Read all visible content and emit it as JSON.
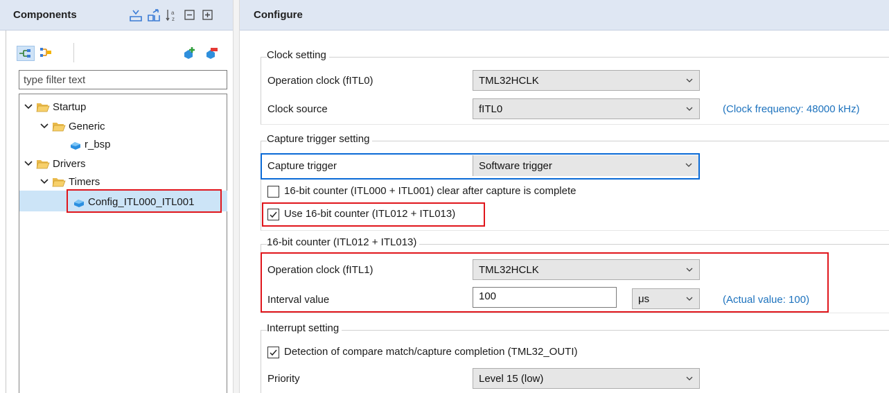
{
  "components": {
    "title": "Components",
    "header_icons": [
      "collapse-view-icon",
      "expand-view-icon",
      "sort-az-icon",
      "collapse-all-icon",
      "expand-all-icon"
    ],
    "toolbar_icons": [
      "hierarchical-view-icon",
      "flat-view-icon",
      "add-component-icon",
      "remove-component-icon"
    ],
    "filter_placeholder": "type filter text",
    "tree": [
      {
        "label": "Startup",
        "type": "folder",
        "expanded": true
      },
      {
        "label": "Generic",
        "type": "folder",
        "expanded": true
      },
      {
        "label": "r_bsp",
        "type": "component"
      },
      {
        "label": "Drivers",
        "type": "folder",
        "expanded": true
      },
      {
        "label": "Timers",
        "type": "folder",
        "expanded": true
      },
      {
        "label": "Config_ITL000_ITL001",
        "type": "component",
        "selected": true
      }
    ]
  },
  "configure": {
    "title": "Configure",
    "clock_setting": {
      "title": "Clock setting",
      "operation_clock_label": "Operation clock (fITL0)",
      "operation_clock_value": "TML32HCLK",
      "clock_source_label": "Clock source",
      "clock_source_value": "fITL0",
      "clock_frequency": "(Clock frequency: 48000 kHz)"
    },
    "capture_trigger_setting": {
      "title": "Capture trigger setting",
      "capture_trigger_label": "Capture trigger",
      "capture_trigger_value": "Software trigger",
      "clear_after_capture_label": "16-bit counter (ITL000 + ITL001) clear after capture is complete",
      "clear_after_capture_checked": false,
      "use_16bit_label": "Use 16-bit counter (ITL012 + ITL013)",
      "use_16bit_checked": true
    },
    "counter_16bit": {
      "title": "16-bit counter (ITL012 + ITL013)",
      "operation_clock_label": "Operation clock (fITL1)",
      "operation_clock_value": "TML32HCLK",
      "interval_label": "Interval value",
      "interval_value": "100",
      "interval_unit": "μs",
      "actual_value": "(Actual value: 100)"
    },
    "interrupt_setting": {
      "title": "Interrupt setting",
      "detection_label": "Detection of compare match/capture completion (TML32_OUTI)",
      "detection_checked": true,
      "priority_label": "Priority",
      "priority_value": "Level 15 (low)"
    }
  },
  "colors": {
    "header_bg": "#dfe7f3",
    "highlight_red": "#e0151b",
    "link_blue": "#1e73be",
    "selection_bg": "#cce4f7",
    "focus_border": "#0a6ad6"
  }
}
